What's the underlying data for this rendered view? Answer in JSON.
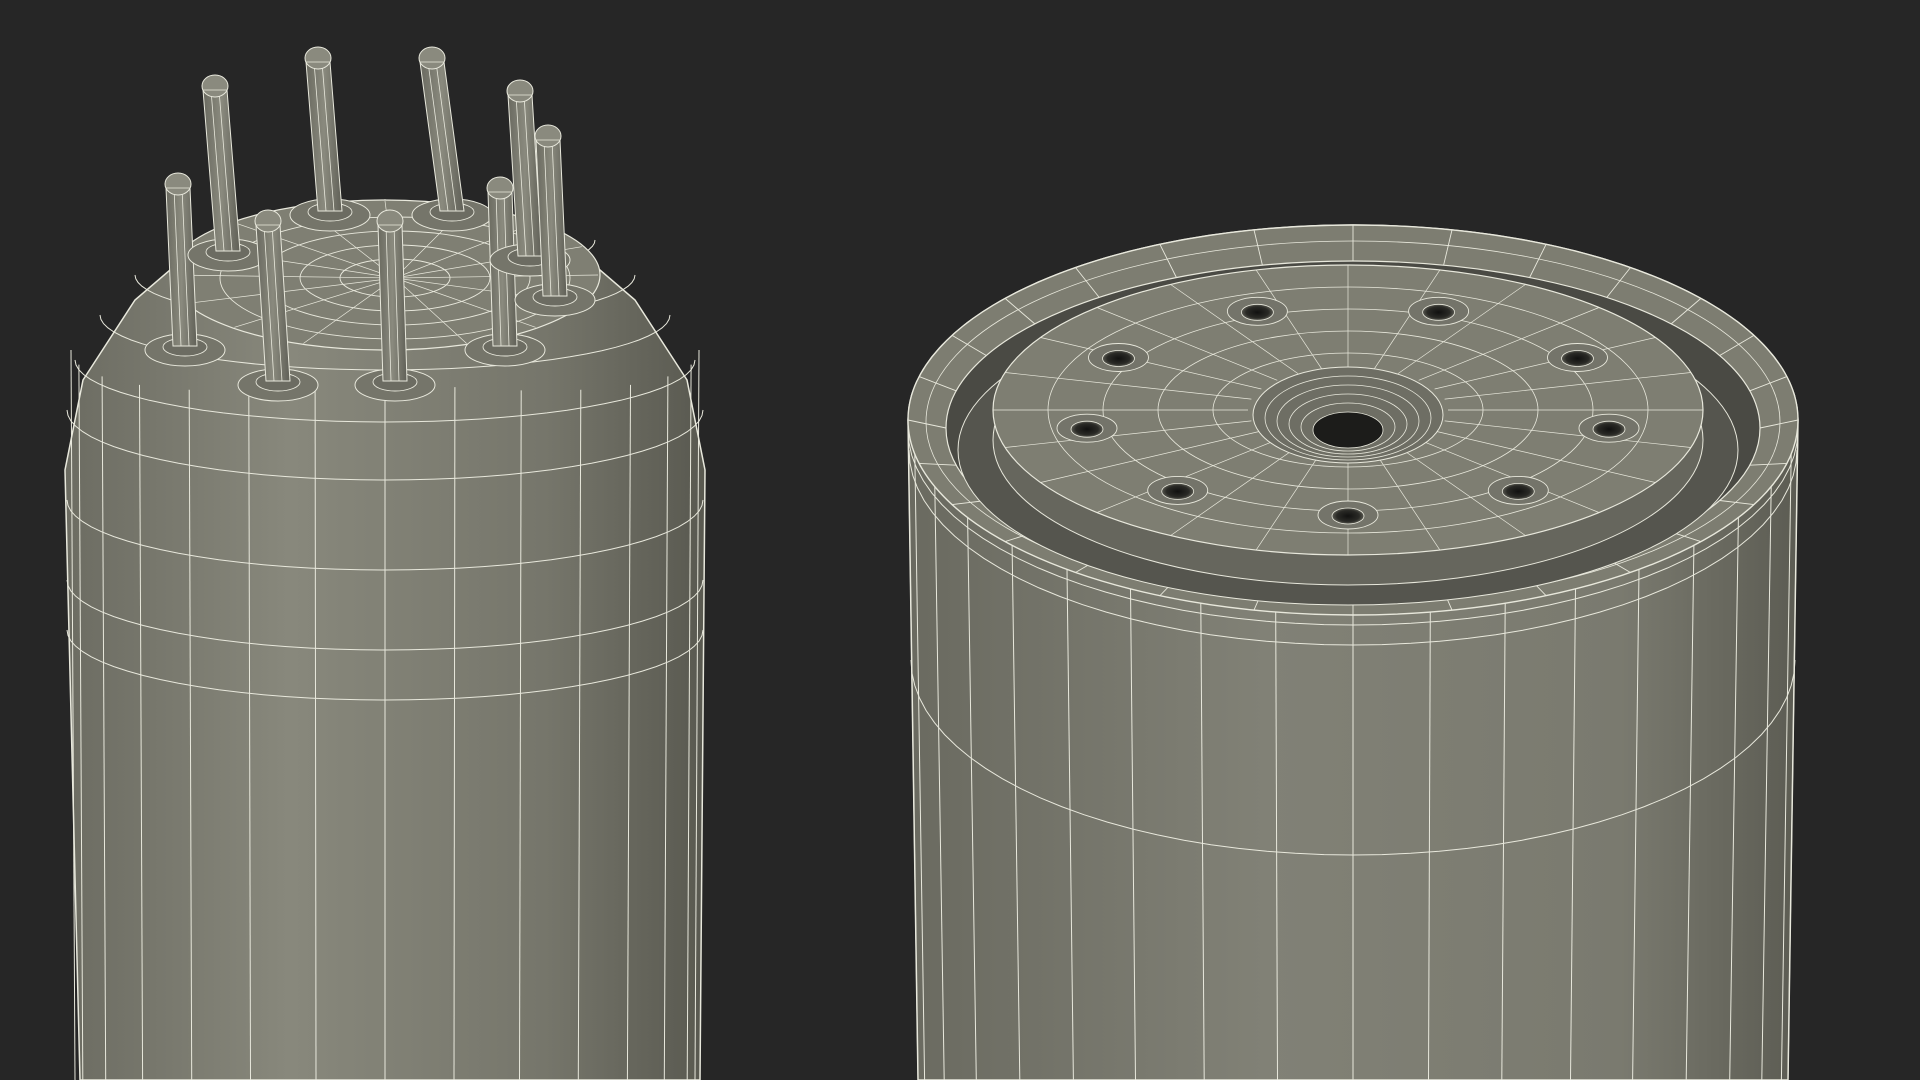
{
  "scene": {
    "background_color": "#262626",
    "surface_color": "#7a7a6e",
    "surface_shadow_color": "#5a5a52",
    "wire_color": "#e8e8dc",
    "dark_hole_color": "#1a1a18"
  },
  "objects": [
    {
      "name": "vacuum-tube-with-pins",
      "pin_count": 9
    },
    {
      "name": "tube-socket-base",
      "pin_hole_count": 9
    }
  ]
}
